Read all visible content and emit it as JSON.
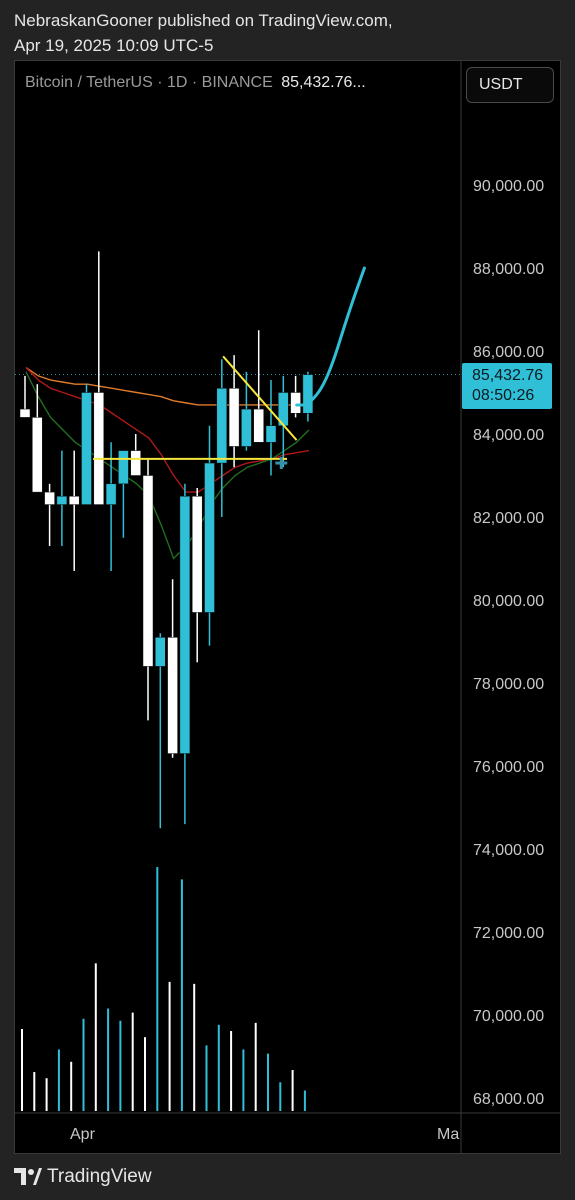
{
  "header": {
    "line1": "NebraskanGooner published on TradingView.com,",
    "line2": "Apr 19, 2025 10:09 UTC-5"
  },
  "symbol": {
    "title": "Bitcoin / TetherUS · 1D · BINANCE",
    "last_price": "85,432.76..."
  },
  "currency_button": "USDT",
  "price_badge": {
    "price": "85,432.76",
    "countdown": "08:50:26"
  },
  "brand": {
    "name": "TradingView"
  },
  "colors": {
    "bull": "#2fc0d8",
    "bear": "#ffffff",
    "ma_orange": "#e07b2a",
    "ma_red": "#b01818",
    "ma_green": "#1f6e1f",
    "trendline": "#f5e63c",
    "projection": "#2fc0d8",
    "volume_bear": "#ffffff"
  },
  "chart_data": {
    "type": "candlestick",
    "y_axis_ticks": [
      "90,000.00",
      "88,000.00",
      "86,000.00",
      "84,000.00",
      "82,000.00",
      "80,000.00",
      "78,000.00",
      "76,000.00",
      "74,000.00",
      "72,000.00",
      "70,000.00",
      "68,000.00"
    ],
    "x_axis_labels": [
      "Apr",
      "Ma"
    ],
    "ylim": [
      67700,
      91700
    ],
    "last_price": 85432.76,
    "candles": [
      {
        "o": 84600,
        "h": 85400,
        "l": 84400,
        "c": 84400
      },
      {
        "o": 84400,
        "h": 85200,
        "l": 83800,
        "c": 82600
      },
      {
        "o": 82600,
        "h": 82800,
        "l": 81300,
        "c": 82300
      },
      {
        "o": 82300,
        "h": 83600,
        "l": 81300,
        "c": 82500
      },
      {
        "o": 82500,
        "h": 83600,
        "l": 80700,
        "c": 82300
      },
      {
        "o": 82300,
        "h": 85200,
        "l": 82300,
        "c": 85000
      },
      {
        "o": 85000,
        "h": 88400,
        "l": 82400,
        "c": 82300
      },
      {
        "o": 82300,
        "h": 83800,
        "l": 80700,
        "c": 82800
      },
      {
        "o": 82800,
        "h": 83500,
        "l": 81500,
        "c": 83600
      },
      {
        "o": 83600,
        "h": 84000,
        "l": 83000,
        "c": 83000
      },
      {
        "o": 83000,
        "h": 83400,
        "l": 77100,
        "c": 78400
      },
      {
        "o": 78400,
        "h": 79200,
        "l": 74500,
        "c": 79100
      },
      {
        "o": 79100,
        "h": 80500,
        "l": 76200,
        "c": 76300
      },
      {
        "o": 76300,
        "h": 82800,
        "l": 74600,
        "c": 82500
      },
      {
        "o": 82500,
        "h": 82700,
        "l": 78500,
        "c": 79700
      },
      {
        "o": 79700,
        "h": 84200,
        "l": 78900,
        "c": 83300
      },
      {
        "o": 83300,
        "h": 85800,
        "l": 82000,
        "c": 85100
      },
      {
        "o": 85100,
        "h": 85900,
        "l": 83200,
        "c": 83700
      },
      {
        "o": 83700,
        "h": 85500,
        "l": 83600,
        "c": 84600
      },
      {
        "o": 84600,
        "h": 86500,
        "l": 83900,
        "c": 83800
      },
      {
        "o": 83800,
        "h": 85300,
        "l": 83000,
        "c": 84200
      },
      {
        "o": 84200,
        "h": 85400,
        "l": 83200,
        "c": 85000
      },
      {
        "o": 85000,
        "h": 85400,
        "l": 84400,
        "c": 84500
      },
      {
        "o": 84500,
        "h": 85500,
        "l": 84300,
        "c": 85430
      }
    ],
    "volume": [
      4.0,
      1.9,
      1.6,
      3.0,
      2.4,
      4.5,
      7.2,
      5.0,
      4.4,
      4.8,
      3.6,
      11.9,
      6.3,
      11.3,
      6.2,
      3.2,
      4.2,
      3.9,
      3.0,
      4.3,
      2.8,
      1.4,
      2.0,
      1.0
    ],
    "moving_averages": [
      {
        "color": "orange",
        "values": [
          85600,
          85400,
          85300,
          85250,
          85200,
          85200,
          85150,
          85100,
          85050,
          85000,
          84950,
          84900,
          84800,
          84750,
          84700,
          84700,
          84700,
          84700,
          84700,
          84700,
          84700,
          84700,
          84700,
          84700
        ]
      },
      {
        "color": "red",
        "values": [
          85600,
          85300,
          85100,
          85000,
          84900,
          84800,
          84700,
          84500,
          84300,
          84100,
          83900,
          83500,
          83000,
          82600,
          82600,
          82800,
          83000,
          83200,
          83300,
          83350,
          83400,
          83500,
          83550,
          83600
        ]
      },
      {
        "color": "green",
        "values": [
          85500,
          84900,
          84400,
          84100,
          83800,
          83600,
          83400,
          83200,
          83000,
          82800,
          82500,
          81800,
          81000,
          81300,
          81700,
          82300,
          82700,
          83000,
          83200,
          83300,
          83400,
          83600,
          83800,
          84100
        ]
      }
    ],
    "annotations": {
      "support_line": 83400,
      "trendline": [
        [
          17.0,
          85800
        ],
        [
          22.0,
          83900
        ]
      ],
      "projection": [
        [
          22.5,
          84700
        ],
        [
          23.5,
          84700
        ],
        [
          25.0,
          85300
        ],
        [
          26.8,
          87000
        ],
        [
          28.0,
          88000
        ]
      ]
    }
  }
}
